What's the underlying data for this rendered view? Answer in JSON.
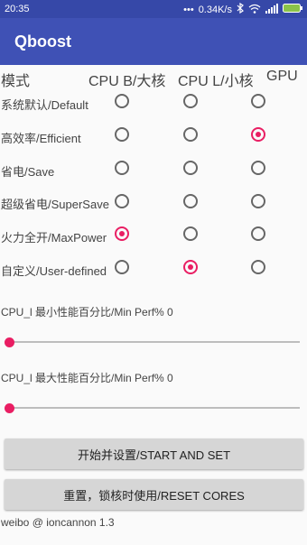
{
  "status_bar": {
    "time": "20:35",
    "network_speed": "0.34K/s",
    "icons": [
      "dots-icon",
      "bluetooth-icon",
      "wifi-icon",
      "signal-icon",
      "battery-icon"
    ]
  },
  "app": {
    "title": "Qboost"
  },
  "columns": {
    "mode": "模式",
    "cpu_big": "CPU B/大核",
    "cpu_little": "CPU L/小核",
    "gpu": "GPU"
  },
  "modes": [
    {
      "label": "系统默认/Default",
      "selected": {
        "cpu_big": false,
        "cpu_little": false,
        "gpu": false
      }
    },
    {
      "label": "高效率/Efficient",
      "selected": {
        "cpu_big": false,
        "cpu_little": false,
        "gpu": true
      }
    },
    {
      "label": "省电/Save",
      "selected": {
        "cpu_big": false,
        "cpu_little": false,
        "gpu": false
      }
    },
    {
      "label": "超级省电/SuperSave",
      "selected": {
        "cpu_big": false,
        "cpu_little": false,
        "gpu": false
      }
    },
    {
      "label": "火力全开/MaxPower",
      "selected": {
        "cpu_big": true,
        "cpu_little": false,
        "gpu": false
      }
    },
    {
      "label": "自定义/User-defined",
      "selected": {
        "cpu_big": false,
        "cpu_little": true,
        "gpu": false
      }
    }
  ],
  "perf": {
    "min_label": "CPU_l 最小性能百分比/Min Perf% 0",
    "min_value": 0,
    "max_label": "CPU_l 最大性能百分比/Min Perf% 0",
    "max_value": 0
  },
  "buttons": {
    "start_set": "开始并设置/START AND SET",
    "reset_cores": "重置，锁核时使用/RESET CORES"
  },
  "footer": "weibo @ ioncannon 1.3",
  "colors": {
    "primary": "#3f51b5",
    "status_bar": "#3648a8",
    "accent": "#e91e63"
  }
}
